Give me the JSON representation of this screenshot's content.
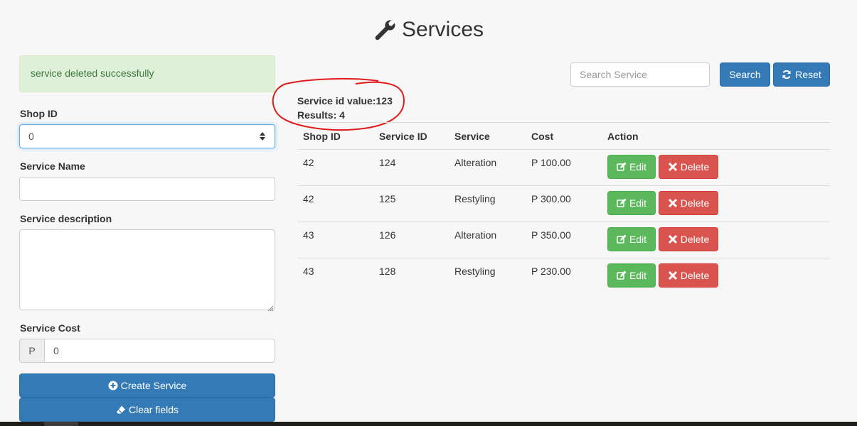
{
  "header": {
    "title": "Services",
    "icon": "wrench-icon"
  },
  "alert": {
    "message": "service deleted successfully",
    "color": "#dff0d8"
  },
  "form": {
    "shop_id_label": "Shop ID",
    "shop_id_value": "0",
    "service_name_label": "Service Name",
    "service_name_value": "",
    "description_label": "Service description",
    "description_value": "",
    "cost_label": "Service Cost",
    "cost_prefix": "P",
    "cost_value": "0",
    "create_label": "Create Service",
    "clear_label": "Clear fields"
  },
  "search": {
    "placeholder": "Search Service",
    "search_label": "Search",
    "reset_label": "Reset"
  },
  "info": {
    "service_id_text": "Service id value:123",
    "results_text": "Results: 4"
  },
  "table": {
    "headers": [
      "Shop ID",
      "Service ID",
      "Service",
      "Cost",
      "Action"
    ],
    "rows": [
      {
        "shop_id": "42",
        "service_id": "124",
        "service": "Alteration",
        "cost": "P 100.00"
      },
      {
        "shop_id": "42",
        "service_id": "125",
        "service": "Restyling",
        "cost": "P 300.00"
      },
      {
        "shop_id": "43",
        "service_id": "126",
        "service": "Alteration",
        "cost": "P 350.00"
      },
      {
        "shop_id": "43",
        "service_id": "128",
        "service": "Restyling",
        "cost": "P 230.00"
      }
    ],
    "edit_label": "Edit",
    "delete_label": "Delete"
  },
  "colors": {
    "primary": "#337ab7",
    "success": "#5cb85c",
    "danger": "#d9534f",
    "annotation": "#e01b1b"
  }
}
